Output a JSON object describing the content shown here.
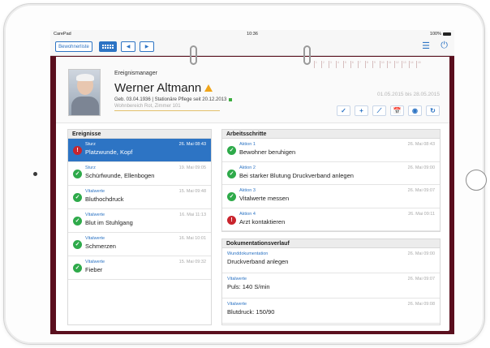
{
  "statusbar": {
    "carrier": "CarePad",
    "time": "10:36",
    "battery": "100%"
  },
  "toolbar": {
    "resident_list": "Bewohnerliste",
    "back": "◀",
    "forward": "▶",
    "list_glyph": "☰",
    "power_glyph": "⏻"
  },
  "header": {
    "app_title": "Ereignismanager",
    "patient_name": "Werner Altmann",
    "patient_info": "Geb. 03.04.1936 | Stationäre Pflege seit 20.12.2013",
    "patient_location": "Wohnbereich Rot, Zimmer 101",
    "date_range": "01.05.2015 bis 28.05.2015",
    "timeline_days": [
      "1",
      "2",
      "3",
      "4",
      "5",
      "6",
      "7",
      "8",
      "9",
      "10",
      "11",
      "12",
      "13",
      "14",
      "15"
    ],
    "actions": [
      "✓",
      "+",
      "⟋",
      "📅",
      "◉",
      "↻"
    ]
  },
  "events": {
    "title": "Ereignisse",
    "items": [
      {
        "category": "Sturz",
        "title": "Platzwunde, Kopf",
        "time": "26. Mai 08:43",
        "status": "alert"
      },
      {
        "category": "Sturz",
        "title": "Schürfwunde, Ellenbogen",
        "time": "19. Mai 09:05",
        "status": "ok"
      },
      {
        "category": "Vitalwerte",
        "title": "Bluthochdruck",
        "time": "15. Mai 09:48",
        "status": "ok"
      },
      {
        "category": "Vitalwerte",
        "title": "Blut im Stuhlgang",
        "time": "16. Mai 11:13",
        "status": "ok"
      },
      {
        "category": "Vitalwerte",
        "title": "Schmerzen",
        "time": "16. Mai 10:01",
        "status": "ok"
      },
      {
        "category": "Vitalwerte",
        "title": "Fieber",
        "time": "15. Mai 09:32",
        "status": "ok"
      }
    ]
  },
  "steps": {
    "title": "Arbeitsschritte",
    "items": [
      {
        "category": "Aktion 1",
        "title": "Bewohner beruhigen",
        "time": "26. Mai 08:43",
        "status": "ok"
      },
      {
        "category": "Aktion 2",
        "title": "Bei starker Blutung Druckverband anlegen",
        "time": "26. Mai 09:00",
        "status": "ok"
      },
      {
        "category": "Aktion 3",
        "title": "Vitalwerte messen",
        "time": "26. Mai 09:07",
        "status": "ok"
      },
      {
        "category": "Aktion 4",
        "title": "Arzt kontaktieren",
        "time": "26. Mai 09:11",
        "status": "alert"
      }
    ]
  },
  "docs": {
    "title": "Dokumentationsverlauf",
    "items": [
      {
        "category": "Wunddokumentation",
        "title": "Druckverband anlegen",
        "time": "26. Mai 09:00"
      },
      {
        "category": "Vitalwerte",
        "title": "Puls: 140 S/min",
        "time": "26. Mai 09:07"
      },
      {
        "category": "Vitalwerte",
        "title": "Blutdruck: 150/90",
        "time": "26. Mai 09:08"
      }
    ]
  }
}
